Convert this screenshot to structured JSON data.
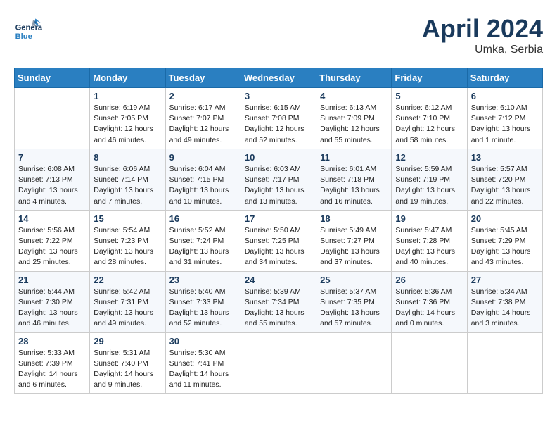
{
  "header": {
    "logo_general": "General",
    "logo_blue": "Blue",
    "month_title": "April 2024",
    "location": "Umka, Serbia"
  },
  "days_of_week": [
    "Sunday",
    "Monday",
    "Tuesday",
    "Wednesday",
    "Thursday",
    "Friday",
    "Saturday"
  ],
  "weeks": [
    [
      {
        "day": "",
        "info": ""
      },
      {
        "day": "1",
        "info": "Sunrise: 6:19 AM\nSunset: 7:05 PM\nDaylight: 12 hours\nand 46 minutes."
      },
      {
        "day": "2",
        "info": "Sunrise: 6:17 AM\nSunset: 7:07 PM\nDaylight: 12 hours\nand 49 minutes."
      },
      {
        "day": "3",
        "info": "Sunrise: 6:15 AM\nSunset: 7:08 PM\nDaylight: 12 hours\nand 52 minutes."
      },
      {
        "day": "4",
        "info": "Sunrise: 6:13 AM\nSunset: 7:09 PM\nDaylight: 12 hours\nand 55 minutes."
      },
      {
        "day": "5",
        "info": "Sunrise: 6:12 AM\nSunset: 7:10 PM\nDaylight: 12 hours\nand 58 minutes."
      },
      {
        "day": "6",
        "info": "Sunrise: 6:10 AM\nSunset: 7:12 PM\nDaylight: 13 hours\nand 1 minute."
      }
    ],
    [
      {
        "day": "7",
        "info": "Sunrise: 6:08 AM\nSunset: 7:13 PM\nDaylight: 13 hours\nand 4 minutes."
      },
      {
        "day": "8",
        "info": "Sunrise: 6:06 AM\nSunset: 7:14 PM\nDaylight: 13 hours\nand 7 minutes."
      },
      {
        "day": "9",
        "info": "Sunrise: 6:04 AM\nSunset: 7:15 PM\nDaylight: 13 hours\nand 10 minutes."
      },
      {
        "day": "10",
        "info": "Sunrise: 6:03 AM\nSunset: 7:17 PM\nDaylight: 13 hours\nand 13 minutes."
      },
      {
        "day": "11",
        "info": "Sunrise: 6:01 AM\nSunset: 7:18 PM\nDaylight: 13 hours\nand 16 minutes."
      },
      {
        "day": "12",
        "info": "Sunrise: 5:59 AM\nSunset: 7:19 PM\nDaylight: 13 hours\nand 19 minutes."
      },
      {
        "day": "13",
        "info": "Sunrise: 5:57 AM\nSunset: 7:20 PM\nDaylight: 13 hours\nand 22 minutes."
      }
    ],
    [
      {
        "day": "14",
        "info": "Sunrise: 5:56 AM\nSunset: 7:22 PM\nDaylight: 13 hours\nand 25 minutes."
      },
      {
        "day": "15",
        "info": "Sunrise: 5:54 AM\nSunset: 7:23 PM\nDaylight: 13 hours\nand 28 minutes."
      },
      {
        "day": "16",
        "info": "Sunrise: 5:52 AM\nSunset: 7:24 PM\nDaylight: 13 hours\nand 31 minutes."
      },
      {
        "day": "17",
        "info": "Sunrise: 5:50 AM\nSunset: 7:25 PM\nDaylight: 13 hours\nand 34 minutes."
      },
      {
        "day": "18",
        "info": "Sunrise: 5:49 AM\nSunset: 7:27 PM\nDaylight: 13 hours\nand 37 minutes."
      },
      {
        "day": "19",
        "info": "Sunrise: 5:47 AM\nSunset: 7:28 PM\nDaylight: 13 hours\nand 40 minutes."
      },
      {
        "day": "20",
        "info": "Sunrise: 5:45 AM\nSunset: 7:29 PM\nDaylight: 13 hours\nand 43 minutes."
      }
    ],
    [
      {
        "day": "21",
        "info": "Sunrise: 5:44 AM\nSunset: 7:30 PM\nDaylight: 13 hours\nand 46 minutes."
      },
      {
        "day": "22",
        "info": "Sunrise: 5:42 AM\nSunset: 7:31 PM\nDaylight: 13 hours\nand 49 minutes."
      },
      {
        "day": "23",
        "info": "Sunrise: 5:40 AM\nSunset: 7:33 PM\nDaylight: 13 hours\nand 52 minutes."
      },
      {
        "day": "24",
        "info": "Sunrise: 5:39 AM\nSunset: 7:34 PM\nDaylight: 13 hours\nand 55 minutes."
      },
      {
        "day": "25",
        "info": "Sunrise: 5:37 AM\nSunset: 7:35 PM\nDaylight: 13 hours\nand 57 minutes."
      },
      {
        "day": "26",
        "info": "Sunrise: 5:36 AM\nSunset: 7:36 PM\nDaylight: 14 hours\nand 0 minutes."
      },
      {
        "day": "27",
        "info": "Sunrise: 5:34 AM\nSunset: 7:38 PM\nDaylight: 14 hours\nand 3 minutes."
      }
    ],
    [
      {
        "day": "28",
        "info": "Sunrise: 5:33 AM\nSunset: 7:39 PM\nDaylight: 14 hours\nand 6 minutes."
      },
      {
        "day": "29",
        "info": "Sunrise: 5:31 AM\nSunset: 7:40 PM\nDaylight: 14 hours\nand 9 minutes."
      },
      {
        "day": "30",
        "info": "Sunrise: 5:30 AM\nSunset: 7:41 PM\nDaylight: 14 hours\nand 11 minutes."
      },
      {
        "day": "",
        "info": ""
      },
      {
        "day": "",
        "info": ""
      },
      {
        "day": "",
        "info": ""
      },
      {
        "day": "",
        "info": ""
      }
    ]
  ]
}
